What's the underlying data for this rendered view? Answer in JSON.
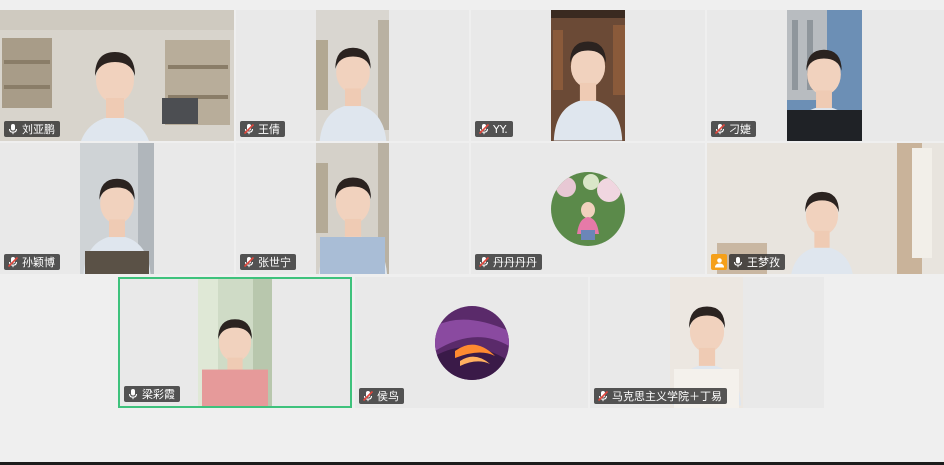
{
  "participants": [
    {
      "name": "刘亚鹏",
      "mic": "on"
    },
    {
      "name": "王倩",
      "mic": "muted"
    },
    {
      "name": "YY.",
      "mic": "muted"
    },
    {
      "name": "刁婕",
      "mic": "muted"
    },
    {
      "name": "孙颖博",
      "mic": "muted"
    },
    {
      "name": "张世宁",
      "mic": "muted"
    },
    {
      "name": "丹丹丹丹",
      "mic": "muted"
    },
    {
      "name": "王梦孜",
      "mic": "on",
      "host": true
    },
    {
      "name": "梁彩霞",
      "mic": "on",
      "speaking": true
    },
    {
      "name": "侯鸟",
      "mic": "muted"
    },
    {
      "name": "马克思主义学院＋丁易",
      "mic": "muted"
    }
  ],
  "colors": {
    "active_border": "#3ec27c",
    "host_badge": "#f5a01a",
    "muted_icon": "#e0463c"
  }
}
